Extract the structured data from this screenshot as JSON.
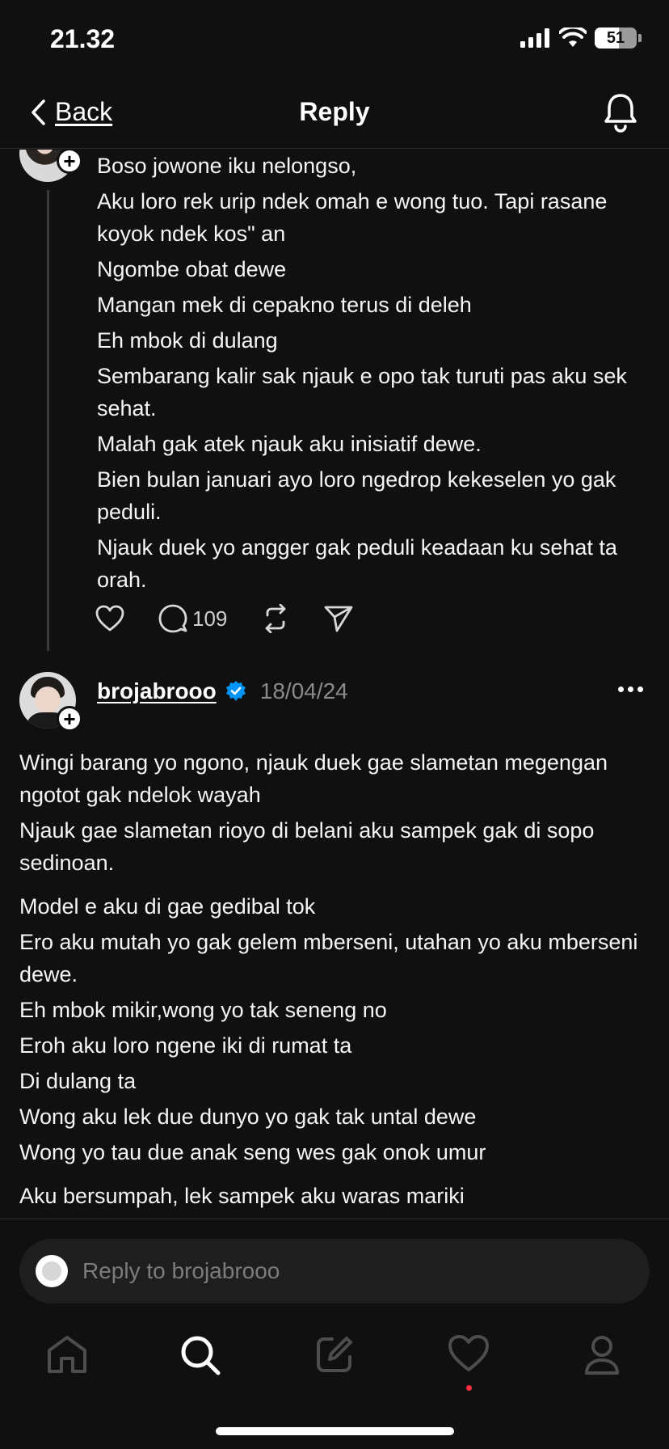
{
  "status_bar": {
    "time": "21.32",
    "battery": "51"
  },
  "header": {
    "back_label": "Back",
    "title": "Reply"
  },
  "previous_post": {
    "lines": [
      "Boso jowone iku nelongso,",
      "Aku loro rek urip ndek omah e wong tuo. Tapi rasane koyok ndek kos\" an",
      "Ngombe obat dewe",
      "Mangan mek di cepakno terus di deleh",
      "Eh mbok di dulang",
      "Sembarang kalir sak njauk e opo tak turuti pas aku sek sehat.",
      "Malah gak atek njauk aku inisiatif dewe.",
      "Bien bulan januari ayo loro ngedrop kekeselen yo gak peduli.",
      "Njauk duek yo angger gak peduli keadaan ku sehat ta orah."
    ],
    "actions": {
      "reply_count": "109"
    }
  },
  "main_post": {
    "username": "brojabrooo",
    "date": "18/04/24",
    "verified_color": "#0095f6",
    "paragraphs": [
      "Wingi barang yo ngono, njauk duek gae slametan megengan ngotot gak ndelok wayah",
      "Njauk gae slametan rioyo di belani aku sampek gak di sopo sedinoan.",
      "Model e aku di gae gedibal tok",
      "Ero aku mutah yo gak gelem mberseni, utahan yo aku mberseni dewe.",
      "Eh mbok mikir,wong yo tak seneng no",
      "Eroh aku loro ngene iki di rumat ta",
      "Di dulang ta",
      "Wong aku lek due dunyo yo gak tak untal dewe",
      "Wong yo tau due anak seng wes gak onok umur",
      "Aku bersumpah, lek sampek aku waras mariki"
    ]
  },
  "reply_input": {
    "placeholder": "Reply to brojabrooo"
  },
  "tab_bar": {
    "items": [
      "home-icon",
      "search-icon",
      "compose-icon",
      "heart-icon",
      "profile-icon"
    ],
    "notification_dot_color": "#ff3040"
  }
}
